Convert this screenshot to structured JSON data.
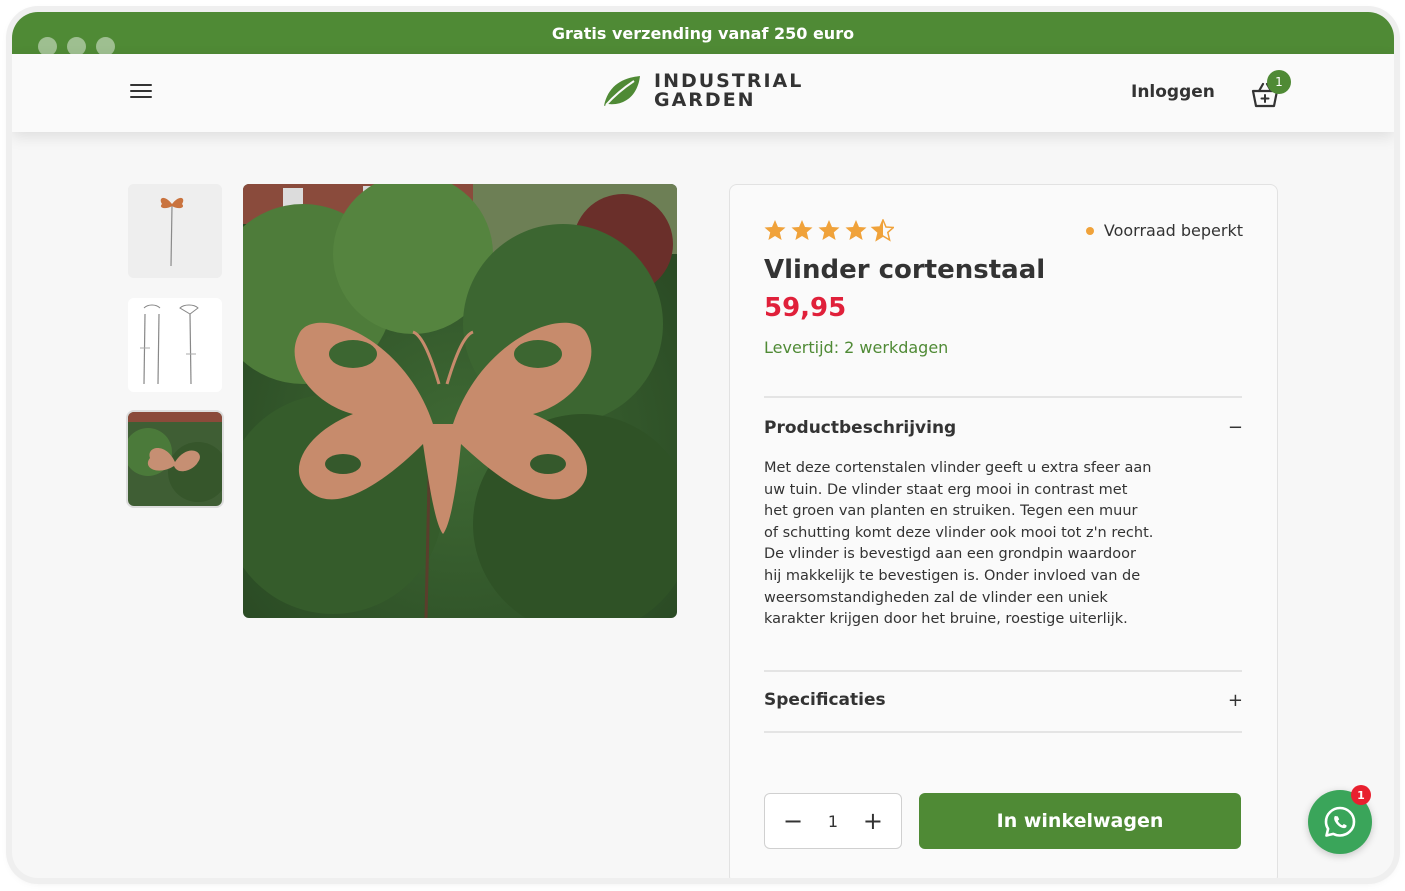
{
  "banner": {
    "text": "Gratis verzending vanaf 250 euro"
  },
  "header": {
    "logo_line1": "INDUSTRIAL",
    "logo_line2": "GARDEN",
    "login_label": "Inloggen",
    "cart_count": "1"
  },
  "gallery": {
    "thumbnails": [
      {
        "alt": "thumbnail-butterfly-stake"
      },
      {
        "alt": "thumbnail-stake-sketch"
      },
      {
        "alt": "thumbnail-butterfly-garden"
      }
    ],
    "active_index": 2
  },
  "product": {
    "rating": 4.5,
    "stock_label": "Voorraad beperkt",
    "title": "Vlinder cortenstaal",
    "price": "59,95",
    "delivery": "Levertijd: 2 werkdagen",
    "description_heading": "Productbeschrijving",
    "description_toggle": "−",
    "description": "Met deze cortenstalen vlinder geeft u extra sfeer aan uw tuin. De vlinder staat erg mooi in contrast met het groen van planten en struiken. Tegen een muur of schutting komt deze vlinder ook mooi tot z'n recht. De vlinder is bevestigd aan een grondpin waardoor hij makkelijk te bevestigen is. Onder invloed van de weersomstandigheden zal de vlinder een uniek karakter krijgen door het bruine, roestige uiterlijk.",
    "specs_heading": "Specificaties",
    "specs_toggle": "+",
    "quantity": "1",
    "add_to_cart_label": "In winkelwagen"
  },
  "chat": {
    "badge_count": "1",
    "icon": "whatsapp-icon"
  },
  "colors": {
    "brand_green": "#4f8a35",
    "price_red": "#e0203a",
    "star_orange": "#f0a23a",
    "whatsapp_green": "#3aa55a"
  }
}
